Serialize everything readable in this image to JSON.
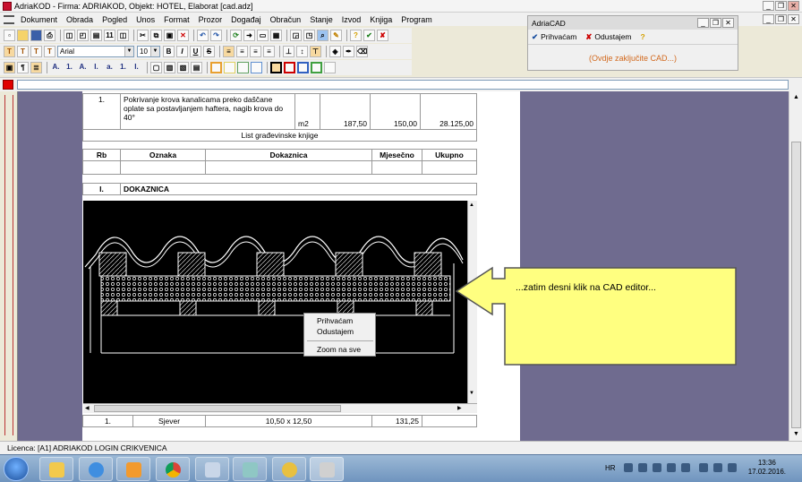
{
  "window": {
    "title": "AdriaKOD - Firma: ADRIAKOD,  Objekt: HOTEL, Elaborat [cad.adz]",
    "btn_min": "_",
    "btn_restore": "❐",
    "btn_close": "✕"
  },
  "menu": [
    "Dokument",
    "Obrada",
    "Pogled",
    "Unos",
    "Format",
    "Prozor",
    "Događaj",
    "Obračun",
    "Stanje",
    "Izvod",
    "Knjiga",
    "Program"
  ],
  "toolbar": {
    "font_name": "Arial",
    "font_size": "10",
    "text_buttons": [
      "T",
      "T",
      "T",
      "T"
    ],
    "bold": "B",
    "italic": "I",
    "underline": "U",
    "strike": "S",
    "list_labels": [
      "A.",
      "1.",
      "A.",
      "I.",
      "a.",
      "1.",
      "I."
    ]
  },
  "cad_panel": {
    "title": "AdriaCAD",
    "accept_label": "Prihvaćam",
    "cancel_label": "Odustajem",
    "hint": "(Ovdje zaključite CAD...)",
    "btn_min": "_",
    "btn_restore": "❐",
    "btn_close": "✕"
  },
  "document": {
    "item_row": {
      "rb": "1.",
      "description": "Pokrivanje krova kanalicama preko daščane oplate sa postavljanjem haftera, nagib krova do 40°",
      "unit": "m2",
      "quantity": "187,50",
      "price": "150,00",
      "total": "28.125,00"
    },
    "list_title": "List građevinske knjige",
    "headers": [
      "Rb",
      "Oznaka",
      "Dokaznica",
      "Mjesečno",
      "Ukupno"
    ],
    "section": {
      "rb": "I.",
      "label": "DOKAZNICA"
    },
    "bottom_row": {
      "rb": "1.",
      "oznaka": "Sjever",
      "dokaznica": "10,50 x 12,50",
      "mjesecno": "131,25"
    }
  },
  "context_menu": {
    "items": [
      "Prihvaćam",
      "Odustajem",
      "Zoom na sve"
    ]
  },
  "callout": {
    "text": "...zatim desni klik na CAD editor...",
    "color": "#ffff80"
  },
  "status": {
    "licence": "Licenca: [A1] ADRIAKOD LOGIN CRIKVENICA"
  },
  "taskbar": {
    "language": "HR",
    "time": "13:36",
    "date": "17.02.2016."
  },
  "colors": {
    "workspace": "#6f6b8f",
    "cad_background": "#000000",
    "hint_text": "#d2691e"
  }
}
